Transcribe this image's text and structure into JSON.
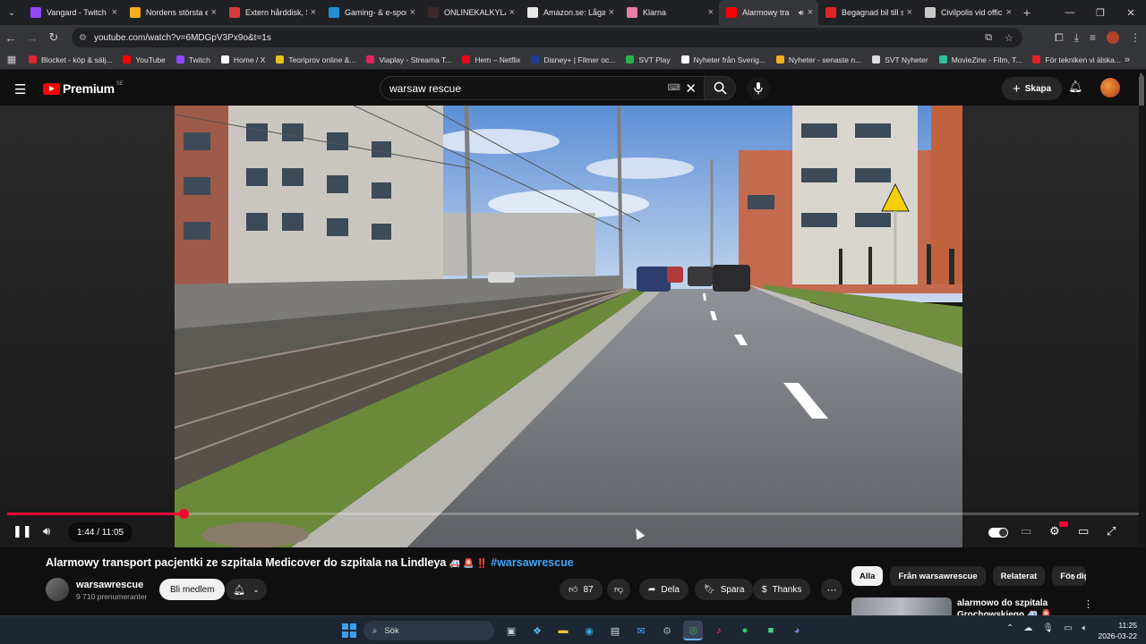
{
  "browser": {
    "tabs": [
      {
        "title": "Vangard - Twitch",
        "color": "#9146ff"
      },
      {
        "title": "Nordens största e",
        "color": "#f2b01e"
      },
      {
        "title": "Extern hårddisk, S",
        "color": "#d63b3b"
      },
      {
        "title": "Gaming- & e-spor",
        "color": "#1f8fd6"
      },
      {
        "title": "ONLINEKALKYLAT",
        "color": "#3a2a2a"
      },
      {
        "title": "Amazon.se: Låga p",
        "color": "#e8e8e8"
      },
      {
        "title": "Klarna",
        "color": "#e67fa8"
      },
      {
        "title": "Alarmowy tra",
        "color": "#ff0000",
        "active": true
      },
      {
        "title": "Begagnad bil till s",
        "color": "#e0242a"
      },
      {
        "title": "Civilpolis vid offic",
        "color": "#c8c8c8"
      }
    ],
    "url": "youtube.com/watch?v=6MDGpV3Px9o&t=1s",
    "bookmarks": [
      {
        "label": "Blocket - köp & sälj...",
        "color": "#e0242a"
      },
      {
        "label": "YouTube",
        "color": "#ff0000"
      },
      {
        "label": "Twitch",
        "color": "#9146ff"
      },
      {
        "label": "Home / X",
        "color": "#ffffff"
      },
      {
        "label": "Teoriprov online &...",
        "color": "#e8c21e"
      },
      {
        "label": "Viaplay - Streama T...",
        "color": "#e0245e"
      },
      {
        "label": "Hem – Netflix",
        "color": "#e50914"
      },
      {
        "label": "Disney+ | Filmer oc...",
        "color": "#1c3f94"
      },
      {
        "label": "SVT Play",
        "color": "#2bb24c"
      },
      {
        "label": "Nyheter från Sverig...",
        "color": "#ffffff"
      },
      {
        "label": "Nyheter - senaste n...",
        "color": "#f2b01e"
      },
      {
        "label": "SVT Nyheter",
        "color": "#dddddd"
      },
      {
        "label": "MovieZine - Film, T...",
        "color": "#2fbf9a"
      },
      {
        "label": "För tekniken vi älska...",
        "color": "#e0242a"
      }
    ]
  },
  "youtube": {
    "logo_text": "Premium",
    "region": "SE",
    "search_query": "warsaw rescue",
    "create_label": "Skapa"
  },
  "player": {
    "current_time": "1:44",
    "duration": "11:05",
    "time_display": "1:44 / 11:05",
    "progress_fraction": 0.156
  },
  "video": {
    "title": "Alarmowy transport pacjentki ze szpitala Medicover do szpitala na Lindleya",
    "title_emoji": "🚑 🚨 ‼️",
    "hashtag": "#warsawrescue",
    "channel": "warsawrescue",
    "subscribers": "9 710 prenumeranter",
    "member_label": "Bli medlem",
    "likes": "87",
    "share_label": "Dela",
    "save_label": "Spara",
    "thanks_label": "Thanks"
  },
  "sidebar": {
    "chips": [
      "Alla",
      "Från warsawrescue",
      "Relaterat",
      "För dig"
    ],
    "recommended": {
      "title": "alarmowo do szpitala Grochowskiego 🚑 🚨 ‼️"
    }
  },
  "taskbar": {
    "search_placeholder": "Sök",
    "time": "11:25",
    "date": "2026-03-22"
  }
}
